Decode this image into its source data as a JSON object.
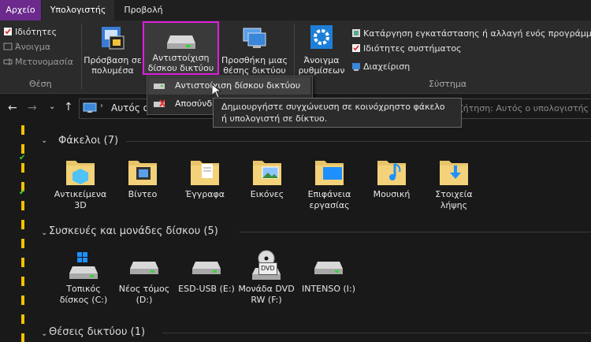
{
  "tabs": [
    "Αρχείο",
    "Υπολογιστής",
    "Προβολή"
  ],
  "ribbon": {
    "location": {
      "properties": "Ιδιότητες",
      "open": "Άνοιγμα",
      "rename": "Μετονομασία",
      "group_label": "Θέση"
    },
    "network": {
      "media_access": "Πρόσβαση σε πολυμέσα",
      "map_drive": "Αντιστοίχιση δίσκου δικτύου",
      "add_location": "Προσθήκη μιας θέσης δικτύου"
    },
    "system": {
      "open_settings": "Άνοιγμα ρυθμίσεων",
      "uninstall": "Κατάργηση εγκατάστασης ή αλλαγή ενός προγράμματος",
      "system_properties": "Ιδιότητες συστήματος",
      "manage": "Διαχείριση",
      "group_label": "Σύστημα"
    }
  },
  "dropdown": {
    "map_item": "Αντιστοίχιση δίσκου δικτύου",
    "disconnect_item": "Αποσύνδεση"
  },
  "tooltip": "Δημιουργήστε συγχώνευση σε κοινόχρηστο φάκελο ή υπολογιστή σε δίκτυο.",
  "address": {
    "path": "Αυτός ο υπολογιστής",
    "search_placeholder": "Αναζήτηση: Αυτός ο υπολογιστής"
  },
  "sections": {
    "folders": "Φάκελοι (7)",
    "devices": "Συσκευές και μονάδες δίσκου (5)",
    "network": "Θέσεις δικτύου (1)"
  },
  "folders": [
    {
      "name": "Αντικείμενα 3D",
      "icon": "3d-objects-folder-icon"
    },
    {
      "name": "Βίντεο",
      "icon": "videos-folder-icon"
    },
    {
      "name": "Έγγραφα",
      "icon": "documents-folder-icon"
    },
    {
      "name": "Εικόνες",
      "icon": "pictures-folder-icon"
    },
    {
      "name": "Επιφάνεια εργασίας",
      "icon": "desktop-folder-icon"
    },
    {
      "name": "Μουσική",
      "icon": "music-folder-icon"
    },
    {
      "name": "Στοιχεία λήψης",
      "icon": "downloads-folder-icon"
    }
  ],
  "devices": [
    {
      "name": "Τοπικός δίσκος (C:)",
      "icon": "windows-drive-icon"
    },
    {
      "name": "Νέος τόμος (D:)",
      "icon": "drive-icon"
    },
    {
      "name": "ESD-USB (E:)",
      "icon": "drive-icon"
    },
    {
      "name": "Μονάδα DVD RW (F:)",
      "icon": "dvd-drive-icon",
      "badge": "DVD"
    },
    {
      "name": "INTENSO (I:)",
      "icon": "drive-icon"
    }
  ],
  "colors": {
    "file_tab": "#6b2a8c",
    "highlight_box": "#e020e0",
    "folder": "#e8c56a",
    "accent_blue": "#1e90ff"
  }
}
